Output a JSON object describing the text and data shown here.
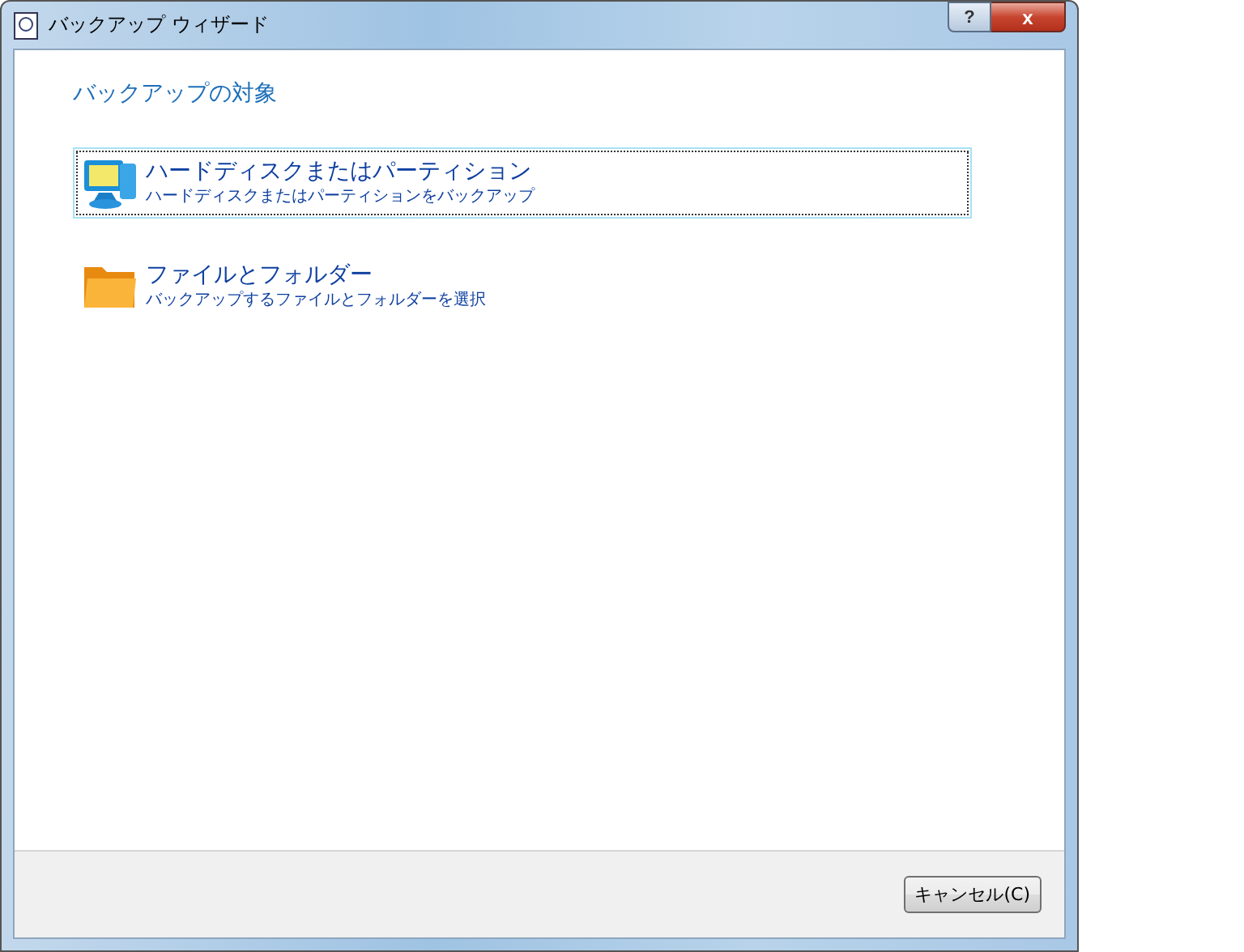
{
  "window": {
    "title": "バックアップ ウィザード",
    "help_button": "?",
    "close_button": "x"
  },
  "heading": "バックアップの対象",
  "options": [
    {
      "kind": "disk",
      "title": "ハードディスクまたはパーティション",
      "description": "ハードディスクまたはパーティションをバックアップ",
      "selected": true
    },
    {
      "kind": "folder",
      "title": "ファイルとフォルダー",
      "description": "バックアップするファイルとフォルダーを選択",
      "selected": false
    }
  ],
  "buttons": [
    "キャンセル(C)"
  ]
}
